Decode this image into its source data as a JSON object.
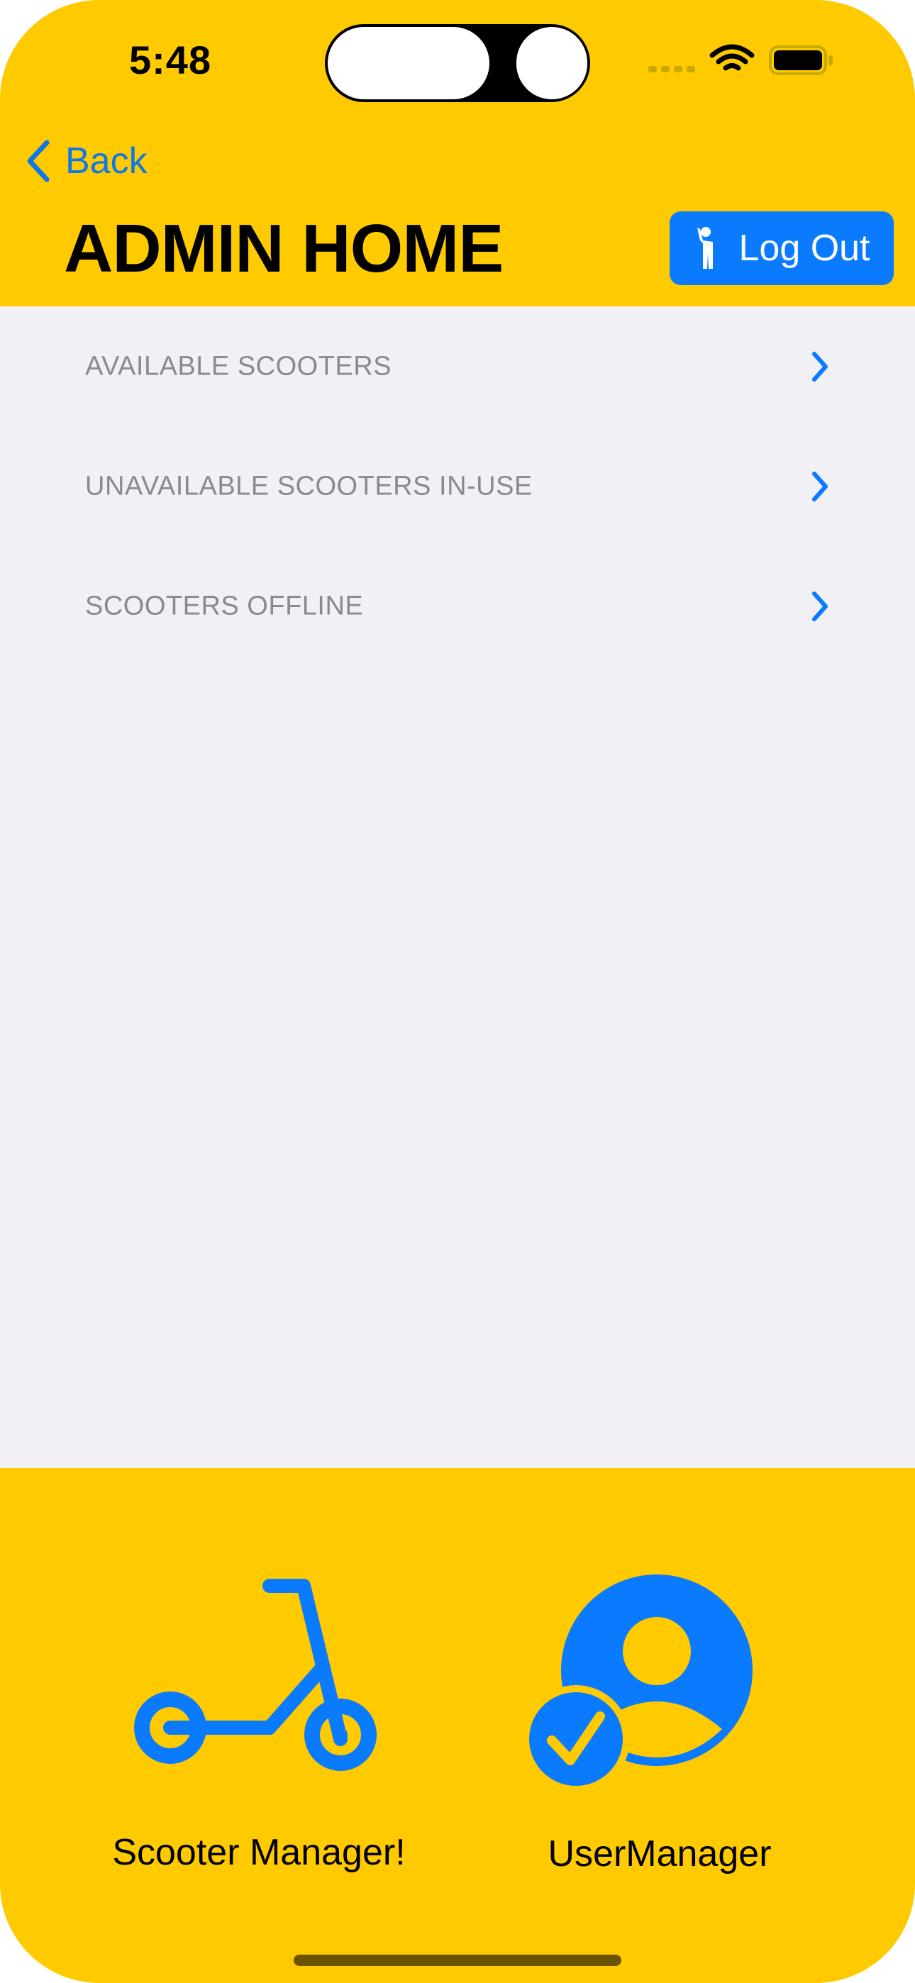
{
  "status_bar": {
    "time": "5:48",
    "icons": [
      "signal-dots-icon",
      "wifi-icon",
      "battery-icon"
    ]
  },
  "nav": {
    "back_label": "Back",
    "title": "ADMIN HOME",
    "logout_label": "Log Out",
    "logout_icon": "figure-wave-icon"
  },
  "list": {
    "items": [
      {
        "label": "AVAILABLE SCOOTERS"
      },
      {
        "label": "UNAVAILABLE SCOOTERS IN-USE"
      },
      {
        "label": "SCOOTERS OFFLINE"
      }
    ]
  },
  "tabs": {
    "scooter_label": "Scooter Manager!",
    "user_label": "UserManager"
  },
  "colors": {
    "accent_yellow": "#ffcb00",
    "accent_blue": "#0a7aff",
    "background": "#f1f0f5",
    "list_text": "#8a8a8e"
  }
}
